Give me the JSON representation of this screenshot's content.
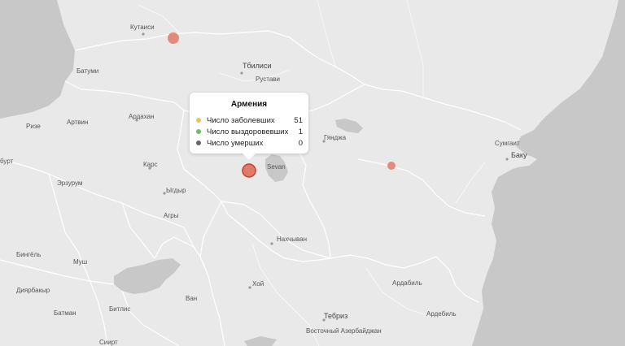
{
  "colors": {
    "land": "#e9e9e9",
    "sea": "#c8c8c8",
    "border": "#ffffff",
    "marker_fill": "#e07a6a",
    "marker_stroke": "#c8402c",
    "confirmed": "#e8c35a",
    "recovered": "#6bbf6b",
    "deaths": "#666666"
  },
  "cities": {
    "kutaisi": "Кутаиси",
    "batumi": "Батуми",
    "tbilisi": "Тбилиси",
    "rustavi": "Рустави",
    "rize": "Ризе",
    "artvin": "Артвин",
    "ardahan": "Ардахан",
    "burt": "бурт",
    "kars": "Карс",
    "erzurum": "Эрзурум",
    "igdir": "Ыгдыр",
    "agry": "Агры",
    "sevan": "Sevan",
    "ganja": "Гянджа",
    "sumgait": "Сумгаит",
    "baku": "Баку",
    "nakhchivan": "Нахчыван",
    "bingol": "Бингёль",
    "mush": "Муш",
    "diyarbakir": "Диярбакыр",
    "batman": "Батман",
    "bitlis": "Битлис",
    "van": "Ван",
    "siirt": "Сиирт",
    "khoy": "Хой",
    "ardabil1": "Ардабиль",
    "ardabil2": "Ардебиль",
    "tabriz": "Тебриз",
    "east_azerbaijan": "Восточный Азербайджан"
  },
  "tooltip": {
    "title": "Армения",
    "rows": [
      {
        "label": "Число заболевших",
        "value": "51",
        "color": "#e8c35a"
      },
      {
        "label": "Число выздоровевших",
        "value": "1",
        "color": "#6bbf6b"
      },
      {
        "label": "Число умерших",
        "value": "0",
        "color": "#666666"
      }
    ]
  },
  "markers": [
    {
      "name": "Georgia"
    },
    {
      "name": "Armenia"
    },
    {
      "name": "Azerbaijan"
    }
  ]
}
